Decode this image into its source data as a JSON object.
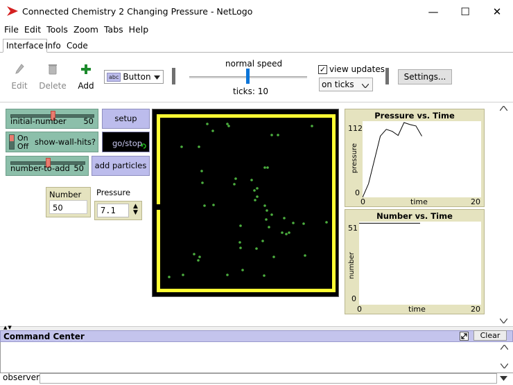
{
  "window": {
    "title": "Connected Chemistry 2 Changing Pressure - NetLogo",
    "minimize_glyph": "—",
    "maximize_glyph": "☐",
    "close_glyph": "✕"
  },
  "menu": [
    "File",
    "Edit",
    "Tools",
    "Zoom",
    "Tabs",
    "Help"
  ],
  "tabs": [
    "Interface",
    "Info",
    "Code"
  ],
  "toolbar": {
    "edit_label": "Edit",
    "delete_label": "Delete",
    "add_label": "Add",
    "widget_type": "Button",
    "widget_type_icon_text": "abc",
    "speed_label": "normal speed",
    "ticks_label": "ticks: 10",
    "view_updates_label": "view updates",
    "view_updates_checked": true,
    "update_mode": "on ticks",
    "settings_label": "Settings..."
  },
  "widgets": {
    "initial_number": {
      "name": "initial-number",
      "value": "50",
      "fraction": 0.5
    },
    "show_wall_hits": {
      "on": "On",
      "off": "Off",
      "name": "show-wall-hits?"
    },
    "number_to_add": {
      "name": "number-to-add",
      "value": "50",
      "fraction": 0.5
    },
    "setup_label": "setup",
    "go_label": "go/stop",
    "add_particles_label": "add particles",
    "number_monitor": {
      "label": "Number",
      "value": "50"
    },
    "pressure_monitor": {
      "label": "Pressure",
      "value": "7.1"
    }
  },
  "pressure_plot": {
    "title": "Pressure vs. Time",
    "ylabel": "pressure",
    "xlabel": "time",
    "ymax_label": "112",
    "ymin_label": "0",
    "xmin_label": "0",
    "xmax_label": "20",
    "color": "#000000"
  },
  "number_plot": {
    "title": "Number vs. Time",
    "ylabel": "number",
    "xlabel": "time",
    "ymax_label": "51",
    "ymin_label": "0",
    "xmin_label": "0",
    "xmax_label": "20",
    "color": "#000000"
  },
  "chart_data": [
    {
      "type": "line",
      "title": "Pressure vs. Time",
      "xlabel": "time",
      "ylabel": "pressure",
      "xlim": [
        0,
        20
      ],
      "ylim": [
        0,
        112
      ],
      "series": [
        {
          "values": [
            [
              0,
              0
            ],
            [
              1,
              20
            ],
            [
              2,
              55
            ],
            [
              3,
              90
            ],
            [
              4,
              100
            ],
            [
              5,
              97
            ],
            [
              6,
              91
            ],
            [
              7,
              110
            ],
            [
              8,
              107
            ],
            [
              9,
              105
            ],
            [
              10,
              90
            ]
          ]
        }
      ]
    },
    {
      "type": "line",
      "title": "Number vs. Time",
      "xlabel": "time",
      "ylabel": "number",
      "xlim": [
        0,
        20
      ],
      "ylim": [
        0,
        51
      ],
      "series": [
        {
          "values": [
            [
              0,
              50
            ],
            [
              10,
              50
            ]
          ]
        }
      ]
    }
  ],
  "command_center": {
    "title": "Command Center",
    "clear_label": "Clear",
    "observer_label": "observer>"
  },
  "colors": {
    "button_bg": "#bcbcec",
    "slider_bg": "#8cbfaa",
    "monitor_bg": "#e5e3bf",
    "world_bg": "#000000",
    "wall_color": "#ffff33",
    "particle_color": "#4caf3f"
  }
}
